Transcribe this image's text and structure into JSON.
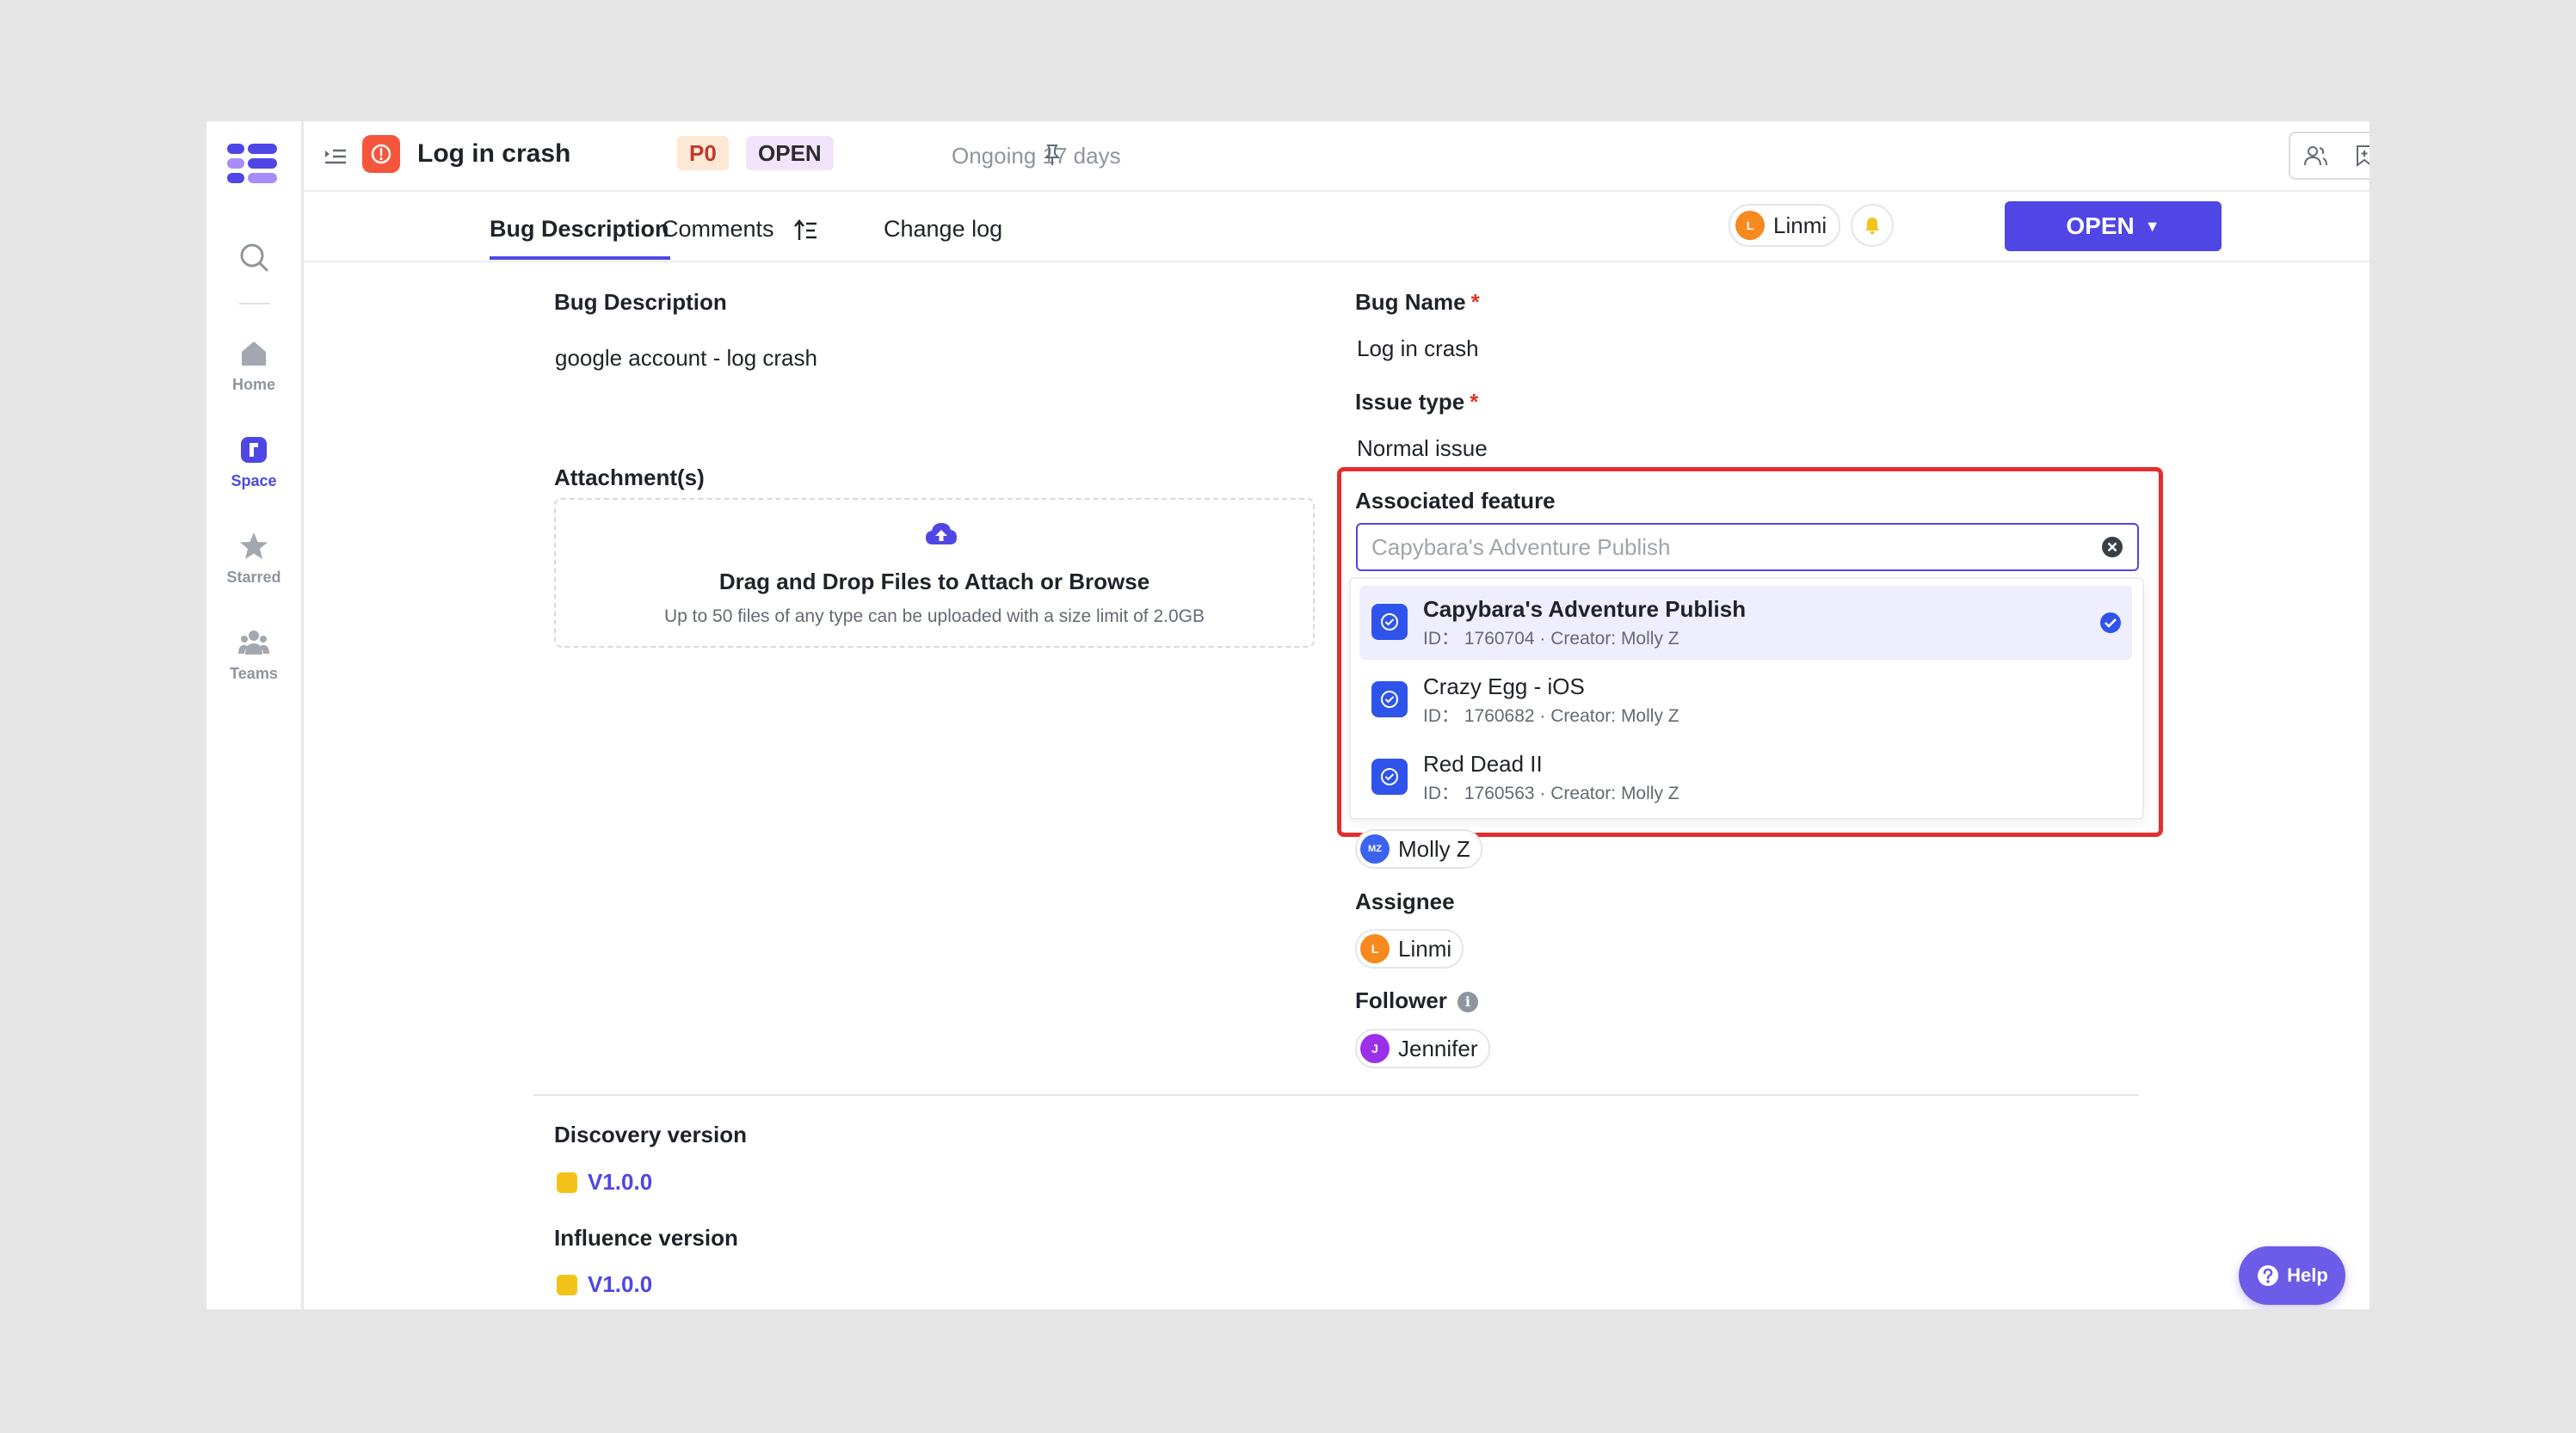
{
  "header": {
    "title": "Log in crash",
    "priority": "P0",
    "status_tag": "OPEN",
    "ongoing": "Ongoing 17 days"
  },
  "rail": {
    "items": [
      {
        "label": "Home"
      },
      {
        "label": "Space"
      },
      {
        "label": "Starred"
      },
      {
        "label": "Teams"
      }
    ]
  },
  "tabs": [
    {
      "label": "Bug Description"
    },
    {
      "label": "Comments"
    },
    {
      "label": "Change log"
    }
  ],
  "owner": {
    "name": "Linmi",
    "initial": "L"
  },
  "status_button": {
    "label": "OPEN",
    "caret": "▼"
  },
  "left": {
    "description_label": "Bug Description",
    "description_text": "google account -  log crash",
    "attachments_label": "Attachment(s)",
    "dropzone_title": "Drag and Drop Files to Attach or Browse",
    "dropzone_sub": "Up to 50 files of any type can be uploaded with a size limit of 2.0GB"
  },
  "right": {
    "bug_name_label": "Bug Name",
    "bug_name_value": "Log in crash",
    "issue_type_label": "Issue type",
    "issue_type_value": "Normal issue",
    "required_mark": "*",
    "associated_feature_label": "Associated feature",
    "associated_feature_placeholder": "Capybara's Adventure Publish",
    "reporter": {
      "name": "Molly Z",
      "initial": "MZ"
    },
    "assignee_label": "Assignee",
    "assignee": {
      "name": "Linmi",
      "initial": "L"
    },
    "follower_label": "Follower",
    "follower": {
      "name": "Jennifer",
      "initial": "J"
    }
  },
  "feature_options": [
    {
      "name": "Capybara's Adventure Publish",
      "meta": "ID： 1760704 · Creator: Molly Z",
      "selected": true
    },
    {
      "name": "Crazy Egg - iOS",
      "meta": "ID： 1760682 · Creator: Molly Z",
      "selected": false
    },
    {
      "name": "Red Dead II",
      "meta": "ID： 1760563 · Creator: Molly Z",
      "selected": false
    }
  ],
  "versions": {
    "discovery_label": "Discovery version",
    "discovery_value": "V1.0.0",
    "influence_label": "Influence version",
    "influence_value": "V1.0.0"
  },
  "help": {
    "label": "Help"
  },
  "colors": {
    "accent": "#4f46e5",
    "bug_icon": "#f5553a",
    "highlight": "#e52d2d",
    "version_dot": "#f4c319",
    "avatar_orange": "#f7891e",
    "avatar_purple": "#9b30e8",
    "avatar_blue": "#3b63f0"
  }
}
